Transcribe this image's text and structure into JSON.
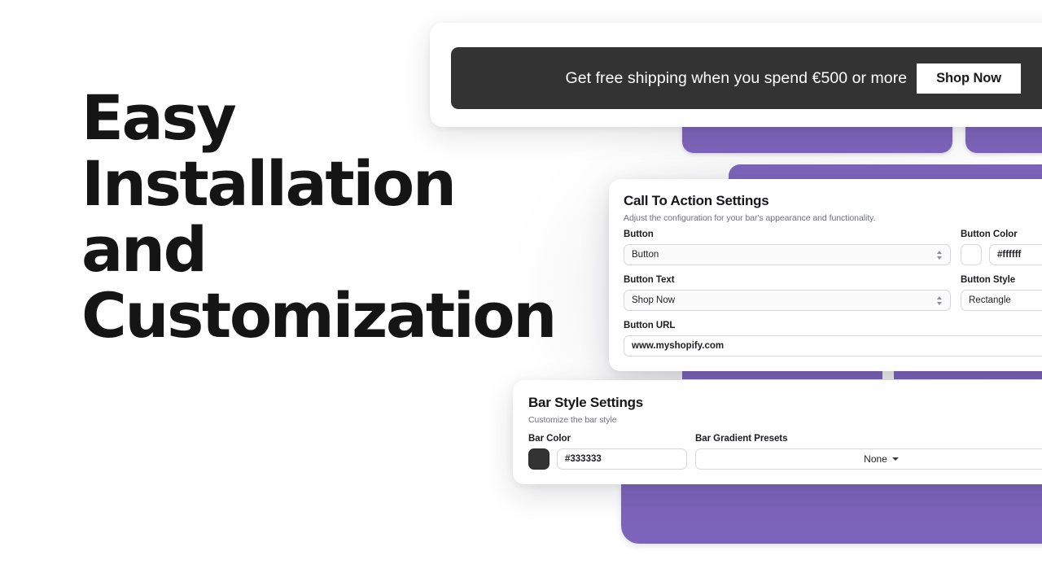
{
  "headline": "Easy\nInstallation and\nCustomization",
  "announcement_bar": {
    "message": "Get free shipping when you spend €500 or more",
    "button_label": "Shop Now",
    "bar_color": "#333333",
    "button_color": "#ffffff"
  },
  "cta_panel": {
    "title": "Call To Action Settings",
    "subtitle": "Adjust the configuration for your bar's appearance and functionality.",
    "fields": {
      "button": {
        "label": "Button",
        "value": "Button"
      },
      "button_text": {
        "label": "Button Text",
        "value": "Shop Now"
      },
      "button_url": {
        "label": "Button URL",
        "value": "www.myshopify.com"
      },
      "button_color": {
        "label": "Button Color",
        "value": "#ffffff",
        "swatch": "#ffffff"
      },
      "button_style": {
        "label": "Button Style",
        "value": "Rectangle"
      }
    }
  },
  "bar_panel": {
    "title": "Bar Style Settings",
    "subtitle": "Customize the bar style",
    "fields": {
      "bar_color": {
        "label": "Bar Color",
        "value": "#333333",
        "swatch": "#333333"
      },
      "bar_gradient_presets": {
        "label": "Bar Gradient Presets",
        "value": "None"
      }
    }
  },
  "theme": {
    "accent_purple": "#7d64bb",
    "dark": "#333333",
    "page_background": "#ffffff"
  }
}
